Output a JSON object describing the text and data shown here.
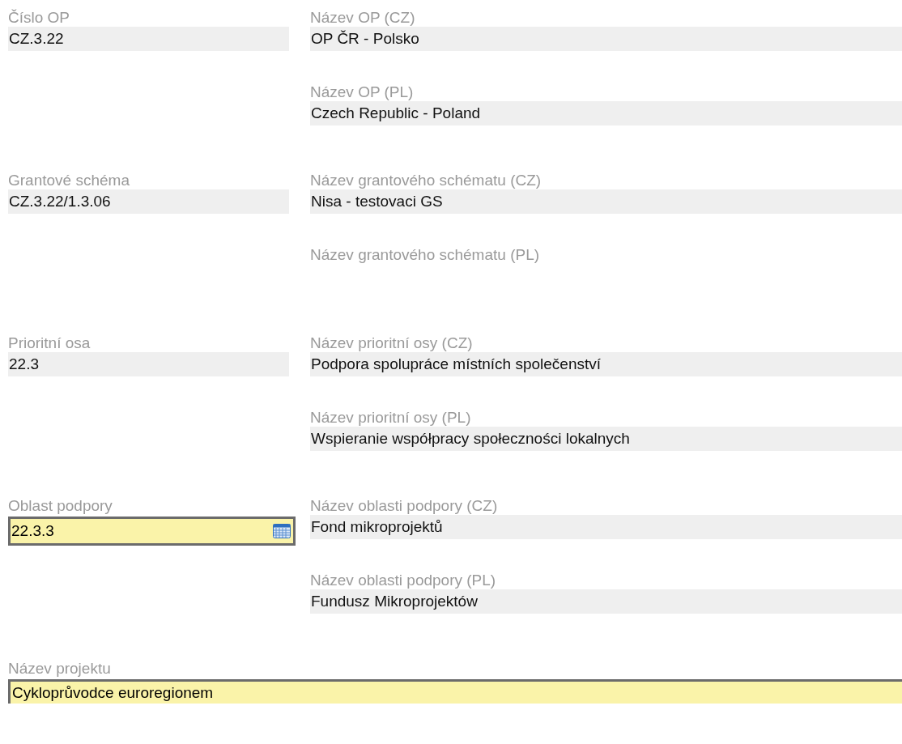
{
  "sections": [
    {
      "left": {
        "kind": "readonly",
        "label": "Číslo OP",
        "value": "CZ.3.22"
      },
      "right": [
        {
          "label": "Název OP (CZ)",
          "value": "OP ČR - Polsko"
        },
        {
          "label": "Název OP (PL)",
          "value": "Czech Republic - Poland"
        }
      ]
    },
    {
      "left": {
        "kind": "readonly",
        "label": "Grantové schéma",
        "value": "CZ.3.22/1.3.06"
      },
      "right": [
        {
          "label": "Název grantového schématu (CZ)",
          "value": "Nisa - testovaci GS"
        },
        {
          "label": "Název grantového schématu (PL)"
        }
      ]
    },
    {
      "left": {
        "kind": "readonly",
        "label": "Prioritní osa",
        "value": "22.3"
      },
      "right": [
        {
          "label": "Název prioritní osy (CZ)",
          "value": "Podpora spolupráce místních společenství"
        },
        {
          "label": "Název prioritní osy (PL)",
          "value": "Wspieranie współpracy społeczności lokalnych"
        }
      ]
    },
    {
      "left": {
        "kind": "picker",
        "label": "Oblast podpory",
        "value": "22.3.3"
      },
      "right": [
        {
          "label": "Název oblasti podpory (CZ)",
          "value": "Fond mikroprojektů"
        },
        {
          "label": "Název oblasti podpory (PL)",
          "value": "Fundusz Mikroprojektów"
        }
      ]
    }
  ],
  "project": {
    "label": "Název projektu",
    "value": "Cykloprůvodce euroregionem"
  }
}
